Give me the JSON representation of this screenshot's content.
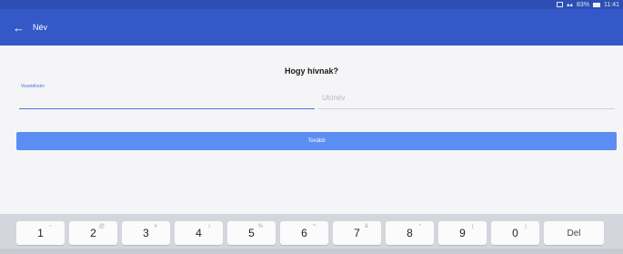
{
  "status_bar": {
    "battery": "83%",
    "time": "11:41"
  },
  "app_bar": {
    "title": "Név"
  },
  "form": {
    "question": "Hogy hívnak?",
    "lastname_label": "Vezetéknév",
    "firstname_placeholder": "Utónév",
    "next_button": "Tovább"
  },
  "keyboard": {
    "keys": [
      {
        "main": "1",
        "sub": "~"
      },
      {
        "main": "2",
        "sub": "@"
      },
      {
        "main": "3",
        "sub": "#"
      },
      {
        "main": "4",
        "sub": "/"
      },
      {
        "main": "5",
        "sub": "%"
      },
      {
        "main": "6",
        "sub": "^"
      },
      {
        "main": "7",
        "sub": "&"
      },
      {
        "main": "8",
        "sub": "*"
      },
      {
        "main": "9",
        "sub": "("
      },
      {
        "main": "0",
        "sub": ")"
      }
    ],
    "delete_label": "Del"
  }
}
